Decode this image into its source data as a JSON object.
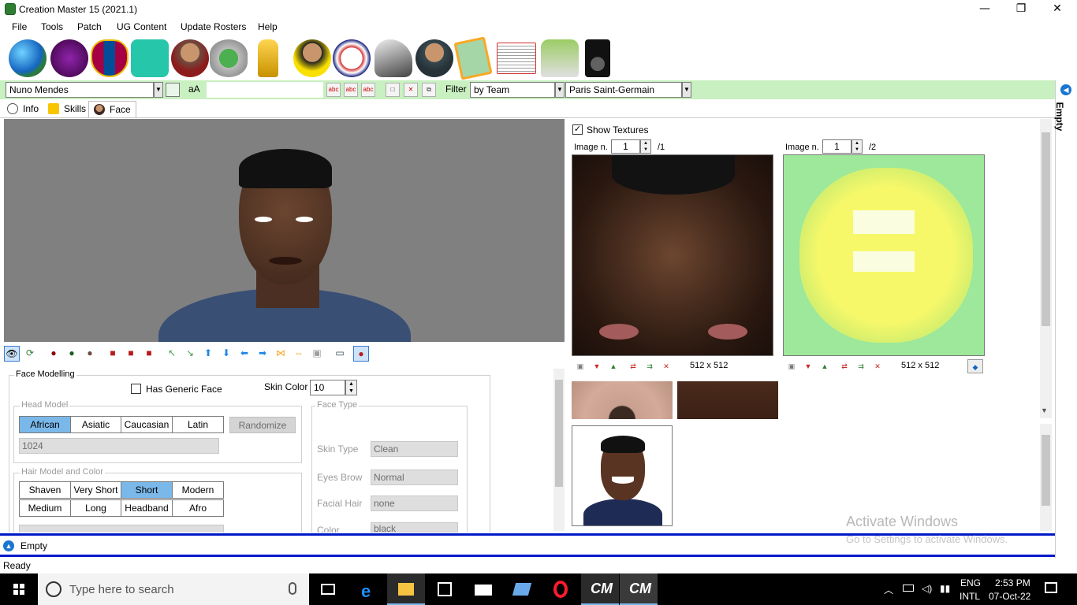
{
  "window": {
    "title": "Creation Master 15 (2021.1)",
    "minimize": "—",
    "maximize": "❐",
    "close": "✕"
  },
  "menu": [
    "File",
    "Tools",
    "Patch",
    "UG Content",
    "Update Rosters",
    "Help"
  ],
  "toolbar": {
    "player_name": "Nuno Mendes",
    "font_toggle": "aA",
    "filter_label": "Filter",
    "filter_value": "by Team",
    "team_value": "Paris Saint-Germain",
    "abc": "abc"
  },
  "tabs": [
    {
      "label": "Info"
    },
    {
      "label": "Skills"
    },
    {
      "label": "Face"
    }
  ],
  "face_modelling": {
    "title": "Face Modelling",
    "has_generic_face": "Has Generic Face",
    "skin_color_label": "Skin Color",
    "skin_color_value": "10",
    "head_model": {
      "title": "Head Model",
      "options": [
        "African",
        "Asiatic",
        "Caucasian",
        "Latin"
      ],
      "selected": "African",
      "randomize": "Randomize",
      "head_id": "1024"
    },
    "hair": {
      "title": "Hair Model and Color",
      "row1": [
        "Shaven",
        "Very Short",
        "Short",
        "Modern"
      ],
      "row2": [
        "Medium",
        "Long",
        "Headband",
        "Afro"
      ],
      "selected": "Short"
    },
    "face_type": {
      "title": "Face Type",
      "skin_type_label": "Skin Type",
      "skin_type_value": "Clean",
      "eyes_brow_label": "Eyes Brow",
      "eyes_brow_value": "Normal",
      "facial_hair_label": "Facial Hair",
      "facial_hair_value": "none",
      "color_label": "Color",
      "color_value": "black"
    }
  },
  "textures": {
    "show_textures": "Show Textures",
    "image_n_label": "Image n.",
    "tex1_index": "1",
    "tex1_total": "/1",
    "tex1_size": "512 x 512",
    "tex2_index": "1",
    "tex2_total": "/2",
    "tex2_size": "512 x 512"
  },
  "watermark": {
    "title": "Activate Windows",
    "subtitle": "Go to Settings to activate Windows."
  },
  "bottom_panel": {
    "label": "Empty"
  },
  "side_panel": {
    "label": "Empty"
  },
  "status": {
    "text": "Ready"
  },
  "taskbar": {
    "search_placeholder": "Type here to search",
    "lang1": "ENG",
    "lang2": "INTL",
    "time": "2:53 PM",
    "date": "07-Oct-22"
  },
  "colors": {
    "accent_blue": "#0019c8",
    "toolbar_green": "#c8f0c0",
    "selected_seg": "#7ab8ea"
  }
}
